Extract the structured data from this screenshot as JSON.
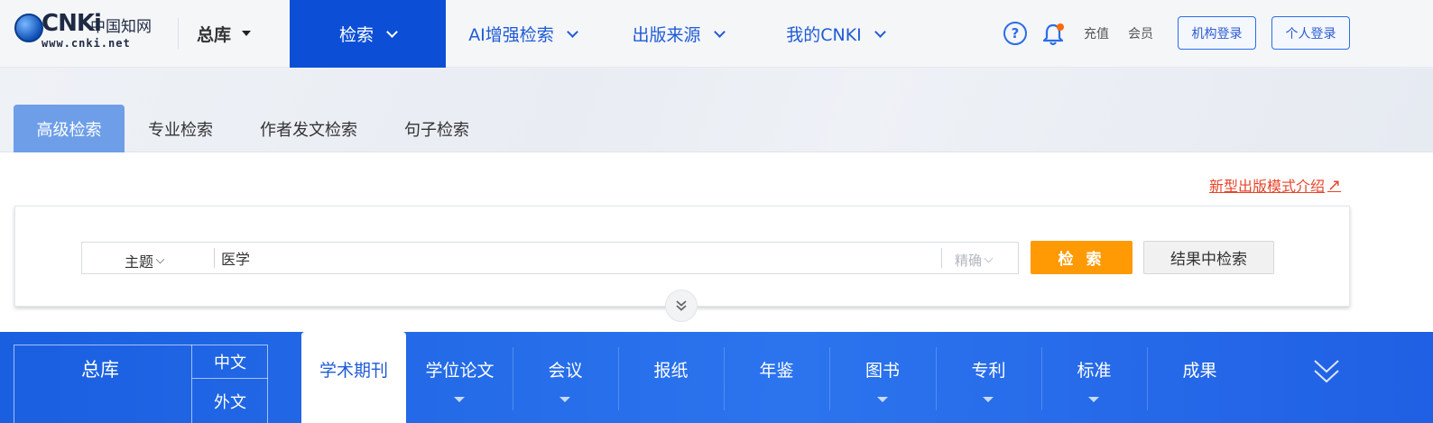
{
  "header": {
    "logo_text": "CNKi",
    "logo_cn": "中国知网",
    "logo_url": "www.cnki.net",
    "db_selector": "总库",
    "nav": [
      {
        "label": "检索",
        "active": true
      },
      {
        "label": "AI增强检索",
        "active": false
      },
      {
        "label": "出版来源",
        "active": false
      },
      {
        "label": "我的CNKI",
        "active": false
      }
    ],
    "recharge": "充值",
    "member": "会员",
    "org_login": "机构登录",
    "personal_login": "个人登录",
    "accent_color": "#0c4fd6",
    "notification_color": "#ff6a00"
  },
  "tabs": [
    {
      "label": "高级检索",
      "active": true
    },
    {
      "label": "专业检索",
      "active": false
    },
    {
      "label": "作者发文检索",
      "active": false
    },
    {
      "label": "句子检索",
      "active": false
    }
  ],
  "intro_link": "新型出版模式介绍",
  "search": {
    "field": "主题",
    "query": "医学",
    "match_mode": "精确",
    "search_button": "检 索",
    "search_within_button": "结果中检索",
    "search_button_color": "#ff9a05"
  },
  "db_bar": {
    "total": "总库",
    "lang_cn": "中文",
    "lang_foreign": "外文",
    "databases": [
      {
        "label": "学术期刊",
        "active": true
      },
      {
        "label": "学位论文",
        "active": false
      },
      {
        "label": "会议",
        "active": false
      },
      {
        "label": "报纸",
        "active": false
      },
      {
        "label": "年鉴",
        "active": false
      },
      {
        "label": "图书",
        "active": false
      },
      {
        "label": "专利",
        "active": false
      },
      {
        "label": "标准",
        "active": false
      },
      {
        "label": "成果",
        "active": false
      }
    ]
  }
}
